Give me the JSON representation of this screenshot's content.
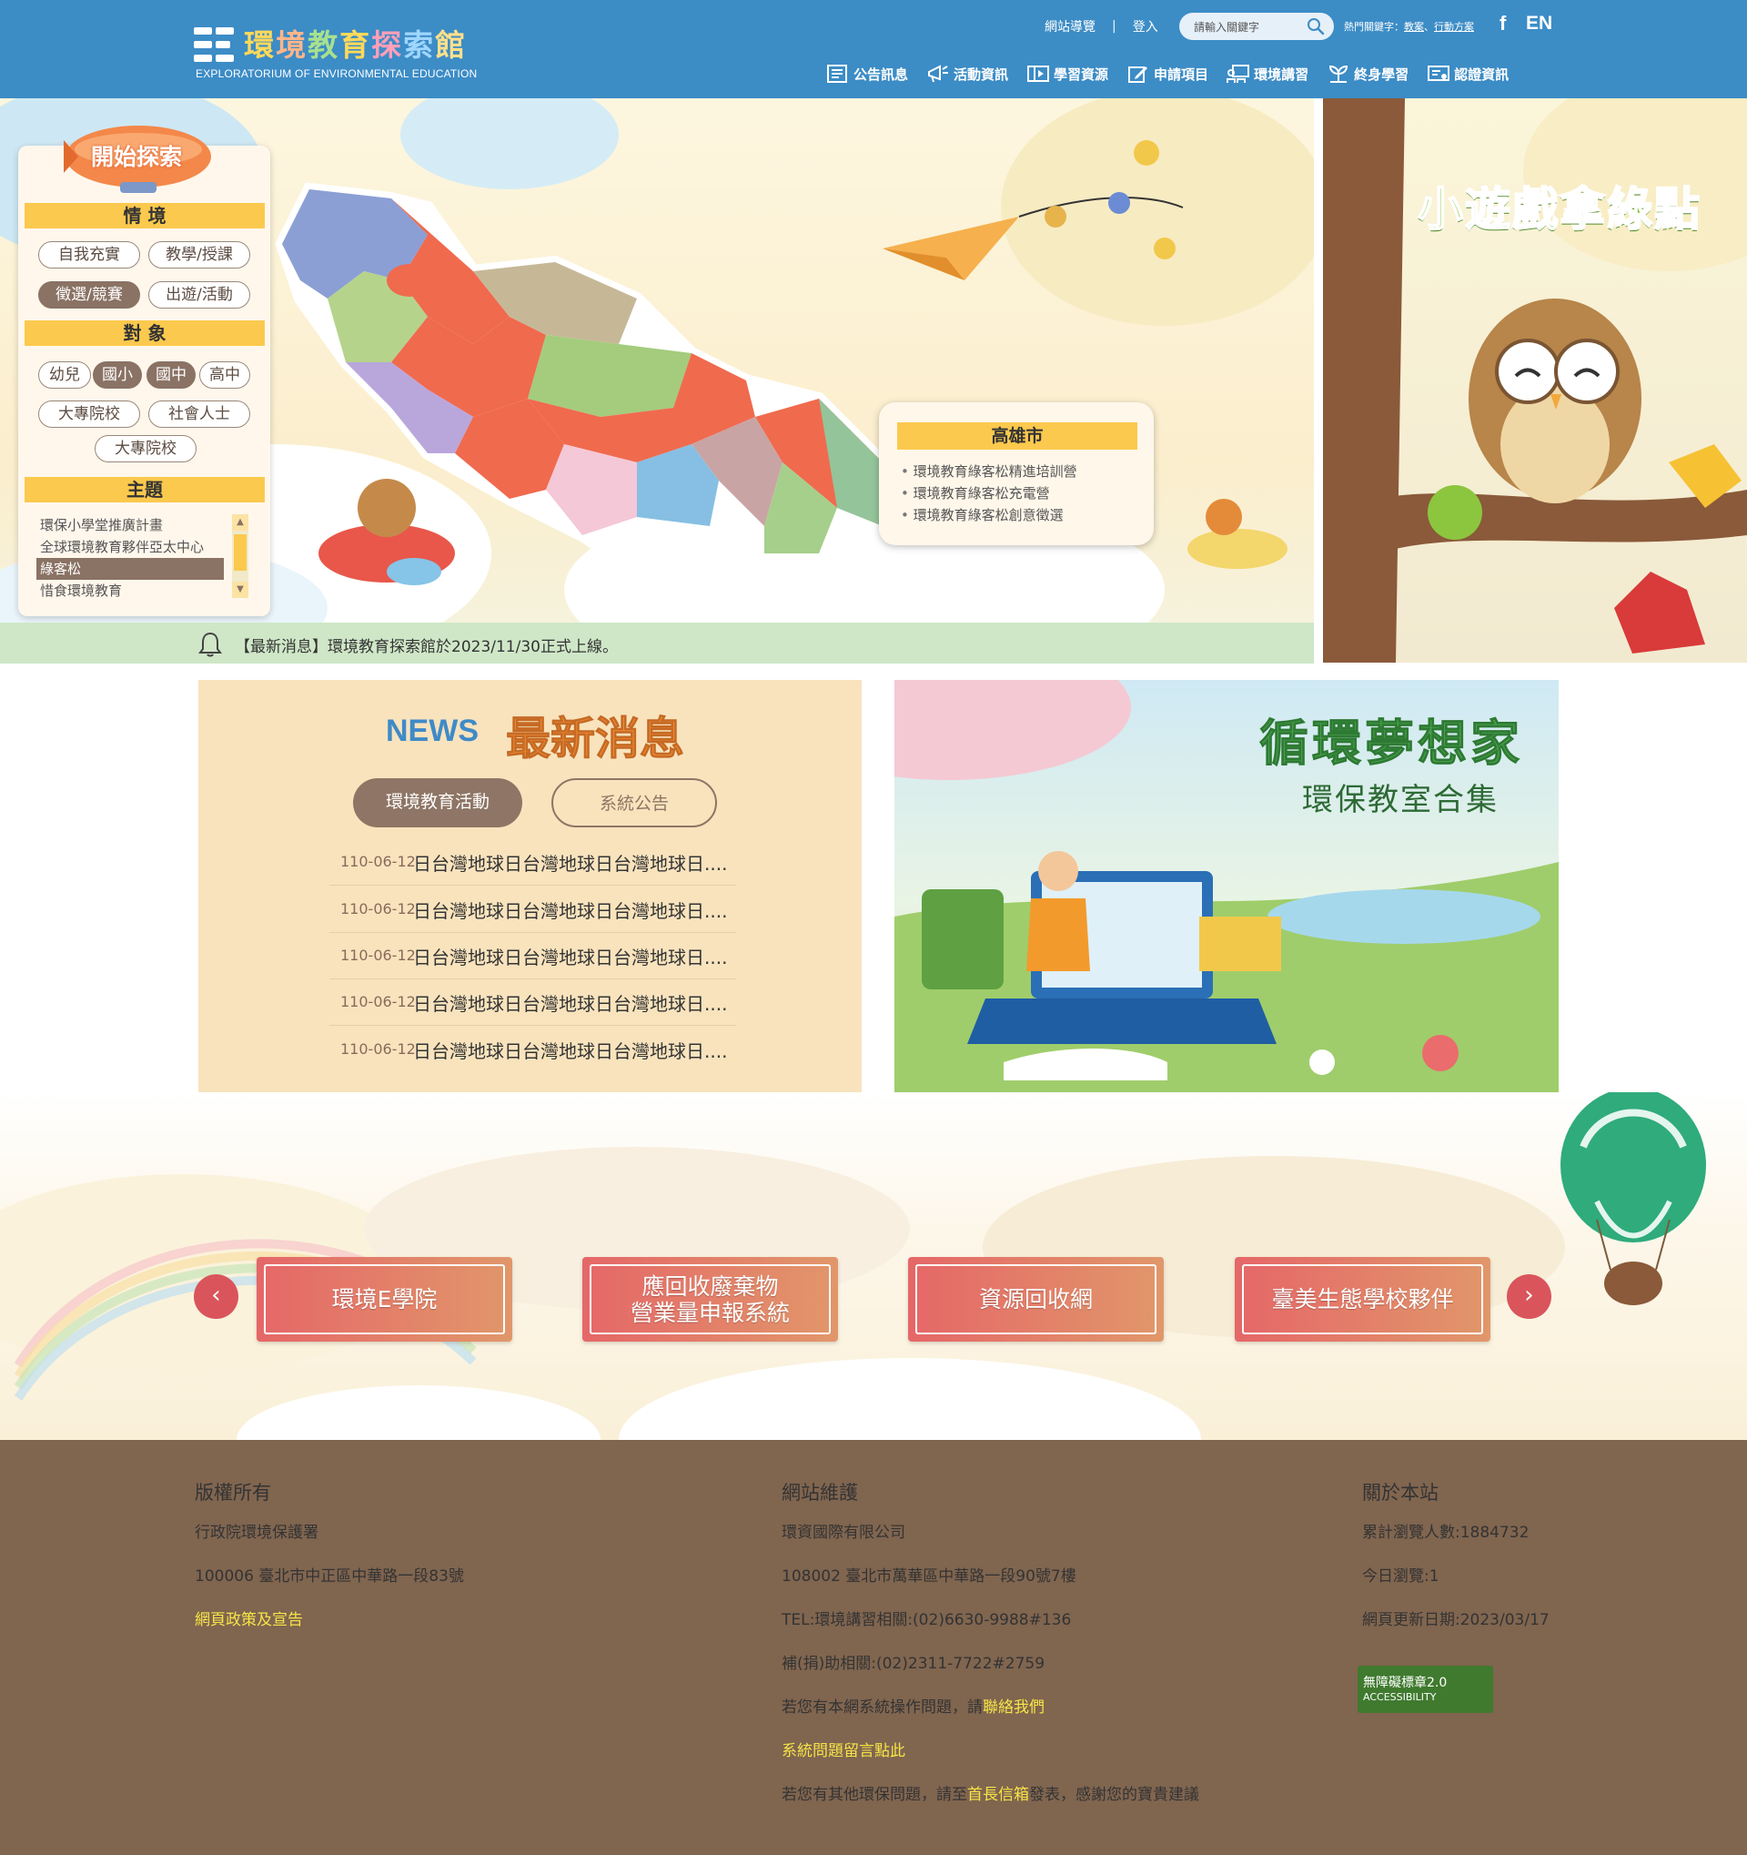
{
  "header": {
    "logo_title": [
      "環",
      "境",
      "教",
      "育",
      "探",
      "索",
      "館"
    ],
    "logo_subtitle": "EXPLORATORIUM OF ENVIRONMENTAL EDUCATION",
    "sitemap": "網站導覽",
    "separator": "|",
    "login": "登入",
    "search_placeholder": "請輸入關鍵字",
    "hot_keywords_label": "熱門關鍵字：",
    "hot_keyword_1": "教案",
    "hot_keyword_sep": "、",
    "hot_keyword_2": "行動方案",
    "facebook": "f",
    "english": "EN",
    "nav": [
      {
        "label": "公告訊息",
        "icon": "newspaper-icon"
      },
      {
        "label": "活動資訊",
        "icon": "megaphone-icon"
      },
      {
        "label": "學習資源",
        "icon": "video-book-icon"
      },
      {
        "label": "申請項目",
        "icon": "edit-icon"
      },
      {
        "label": "環境講習",
        "icon": "classroom-icon"
      },
      {
        "label": "終身學習",
        "icon": "growth-icon"
      },
      {
        "label": "認證資訊",
        "icon": "certificate-icon"
      }
    ]
  },
  "panel": {
    "title": "開始探索",
    "section_context": "情 境",
    "context_chips": [
      {
        "label": "自我充實",
        "selected": false
      },
      {
        "label": "教學/授課",
        "selected": false
      },
      {
        "label": "徵選/競賽",
        "selected": true
      },
      {
        "label": "出遊/活動",
        "selected": false
      }
    ],
    "section_target": "對 象",
    "target_chips": [
      {
        "label": "幼兒",
        "selected": false
      },
      {
        "label": "國小",
        "selected": true
      },
      {
        "label": "國中",
        "selected": true
      },
      {
        "label": "高中",
        "selected": false
      },
      {
        "label": "大專院校",
        "selected": false
      },
      {
        "label": "社會人士",
        "selected": false
      },
      {
        "label": "大專院校",
        "selected": false
      }
    ],
    "section_topic": "主題",
    "topics": [
      "環保小學堂推廣計畫",
      "全球環境教育夥伴亞太中心",
      "綠客松",
      "惜食環境教育"
    ],
    "selected_topic_index": 2,
    "scroll_up": "▲",
    "scroll_down": "▼"
  },
  "map": {
    "tooltip_title": "高雄市",
    "tooltip_items": [
      "環境教育綠客松精進培訓營",
      "環境教育綠客松充電營",
      "環境教育綠客松創意徵選"
    ]
  },
  "ticker": {
    "text": "【最新消息】環境教育探索館於2023/11/30正式上線。"
  },
  "game_banner": {
    "title": "小遊戲拿綠點"
  },
  "news": {
    "badge": "NEWS",
    "title": "最新消息",
    "tabs": [
      {
        "label": "環境教育活動",
        "active": true
      },
      {
        "label": "系統公告",
        "active": false
      }
    ],
    "items": [
      {
        "date": "110-06-12",
        "title": "日台灣地球日台灣地球日台灣地球日...."
      },
      {
        "date": "110-06-12",
        "title": "日台灣地球日台灣地球日台灣地球日...."
      },
      {
        "date": "110-06-12",
        "title": "日台灣地球日台灣地球日台灣地球日...."
      },
      {
        "date": "110-06-12",
        "title": "日台灣地球日台灣地球日台灣地球日...."
      },
      {
        "date": "110-06-12",
        "title": "日台灣地球日台灣地球日台灣地球日...."
      }
    ]
  },
  "promo": {
    "title": "循環夢想家",
    "subtitle": "環保教室合集"
  },
  "links": {
    "prev": "‹",
    "next": "›",
    "items": [
      {
        "line1": "環境E學院",
        "line2": ""
      },
      {
        "line1": "應回收廢棄物",
        "line2": "營業量申報系統"
      },
      {
        "line1": "資源回收網",
        "line2": ""
      },
      {
        "line1": "臺美生態學校夥伴",
        "line2": ""
      }
    ]
  },
  "footer": {
    "col1": {
      "heading": "版權所有",
      "org": "行政院環境保護署",
      "address": "100006 臺北市中正區中華路一段83號",
      "policy": "網頁政策及宣告"
    },
    "col2": {
      "heading": "網站維護",
      "company": "環資國際有限公司",
      "address": "108002 臺北市萬華區中華路一段90號7樓",
      "tel": "TEL:環境講習相關:(02)6630-9988#136",
      "grant": "補(捐)助相關:(02)2311-7722#2759",
      "contact_prefix": "若您有本網系統操作問題，請",
      "contact_link": "聯絡我們",
      "feedback": "系統問題留言點此",
      "mailbox_prefix": "若您有其他環保問題，請至",
      "mailbox_link": "首長信箱",
      "mailbox_suffix": "發表，感謝您的寶貴建議"
    },
    "col3": {
      "heading": "關於本站",
      "total_visits": "累計瀏覽人數:1884732",
      "today_visits": "今日瀏覽:1",
      "updated": "網頁更新日期:2023/03/17",
      "badge_title": "無障礙標章2.0",
      "badge_sub": "ACCESSIBILITY"
    }
  },
  "colors": {
    "header_blue": "#3c8cc6",
    "accent_yellow": "#fbc94d",
    "chip_brown": "#8a7264",
    "footer_brown": "#80654f",
    "link_red": "#e56768",
    "link_yellow": "#f5e447"
  }
}
